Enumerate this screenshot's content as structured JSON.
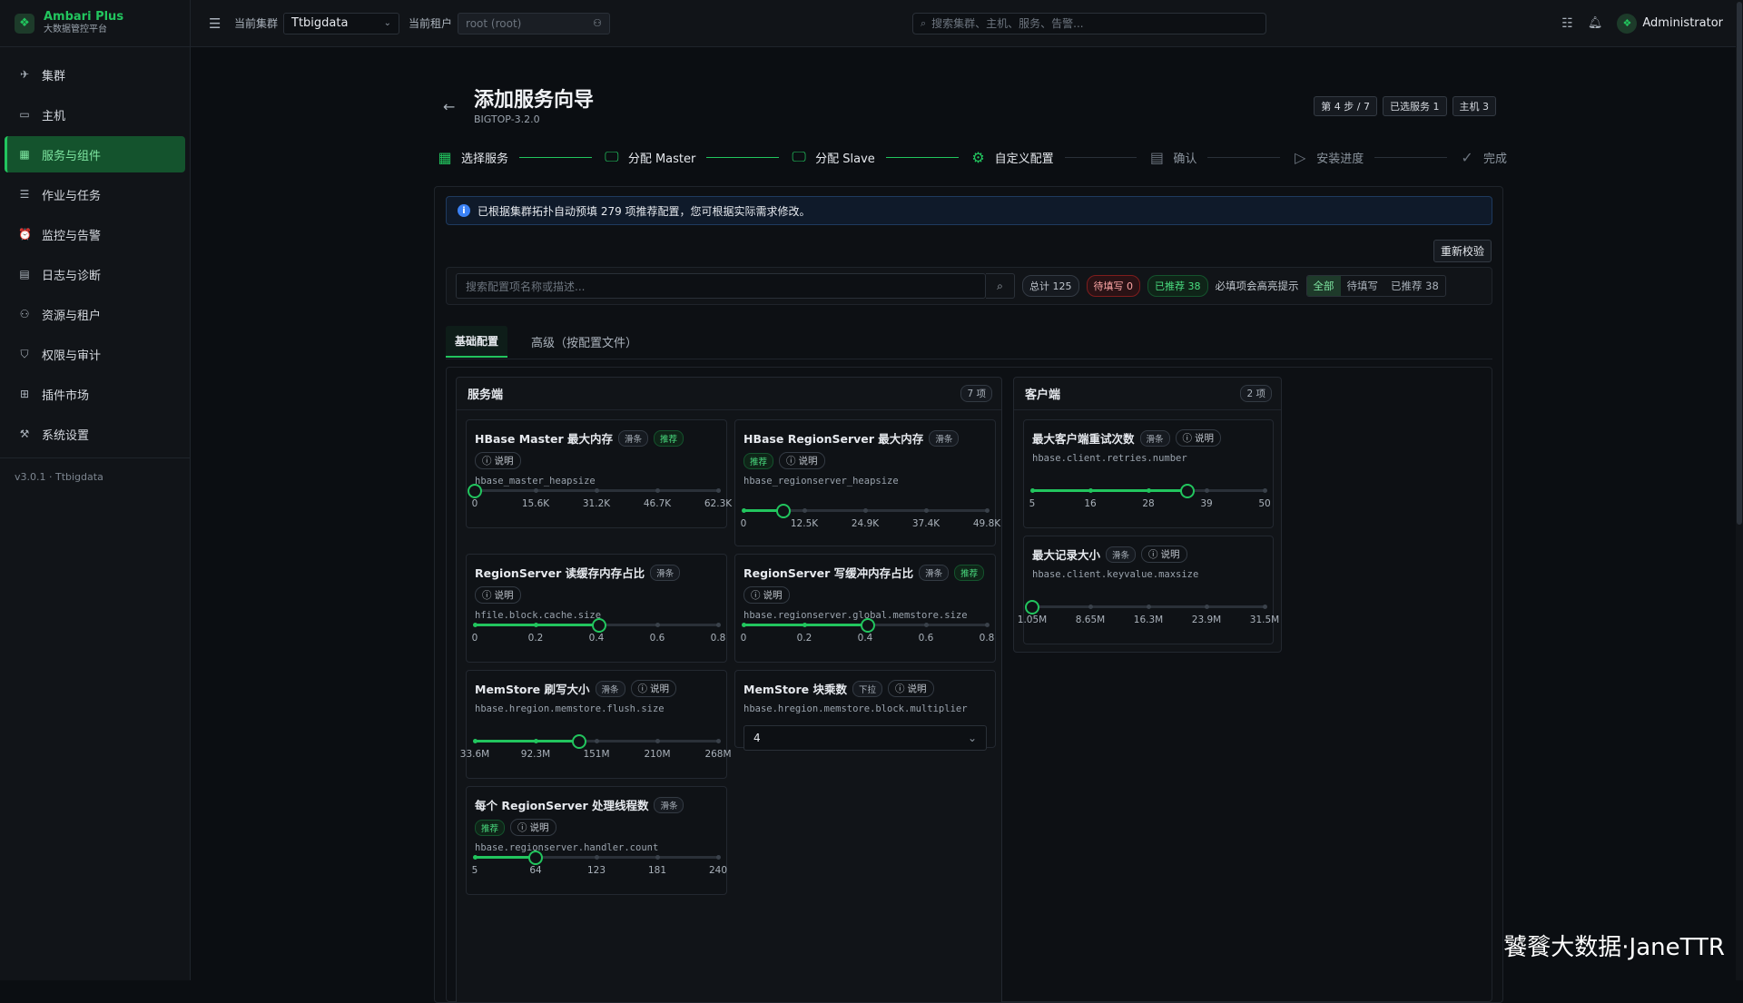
{
  "brand": {
    "title": "Ambari Plus",
    "subtitle": "大数据管控平台"
  },
  "sidebar": {
    "items": [
      {
        "label": "集群",
        "icon": "rocket-icon"
      },
      {
        "label": "主机",
        "icon": "monitor-icon"
      },
      {
        "label": "服务与组件",
        "icon": "grid-icon",
        "active": true
      },
      {
        "label": "作业与任务",
        "icon": "list-icon"
      },
      {
        "label": "监控与告警",
        "icon": "alarm-icon"
      },
      {
        "label": "日志与诊断",
        "icon": "log-icon"
      },
      {
        "label": "资源与租户",
        "icon": "users-icon"
      },
      {
        "label": "权限与审计",
        "icon": "shield-icon"
      },
      {
        "label": "插件市场",
        "icon": "puzzle-icon"
      },
      {
        "label": "系统设置",
        "icon": "wrench-icon"
      }
    ],
    "version": "v3.0.1 · Ttbigdata"
  },
  "topbar": {
    "cluster_label": "当前集群",
    "cluster_value": "Ttbigdata",
    "tenant_label": "当前租户",
    "tenant_placeholder": "root (root)",
    "search_placeholder": "搜索集群、主机、服务、告警...",
    "user": "Administrator"
  },
  "page": {
    "title": "添加服务向导",
    "subtitle": "BIGTOP-3.2.0",
    "badges": [
      "第 4 步 / 7",
      "已选服务 1",
      "主机 3"
    ]
  },
  "steps": [
    {
      "label": "选择服务",
      "state": "done",
      "icon": "grid-icon"
    },
    {
      "label": "分配 Master",
      "state": "done",
      "icon": "monitor-icon"
    },
    {
      "label": "分配 Slave",
      "state": "done",
      "icon": "monitor-icon"
    },
    {
      "label": "自定义配置",
      "state": "current",
      "icon": "gear-icon"
    },
    {
      "label": "确认",
      "state": "pending",
      "icon": "document-icon"
    },
    {
      "label": "安装进度",
      "state": "pending",
      "icon": "play-icon"
    },
    {
      "label": "完成",
      "state": "pending",
      "icon": "check-circle-icon"
    }
  ],
  "banner": "已根据集群拓扑自动预填 279 项推荐配置，您可根据实际需求修改。",
  "revalidate_label": "重新校验",
  "filter": {
    "search_placeholder": "搜索配置项名称或描述...",
    "total": "总计 125",
    "pending": "待填写 0",
    "recommended": "已推荐 38",
    "hint": "必填项会高亮提示",
    "segments": [
      "全部",
      "待填写",
      "已推荐 38"
    ],
    "active_segment": "全部"
  },
  "tabs": {
    "basic": "基础配置",
    "advanced": "高级（按配置文件）"
  },
  "common": {
    "explain": "说明",
    "slider_tag": "滑条",
    "dropdown_tag": "下拉",
    "recommended_tag": "推荐"
  },
  "server": {
    "title": "服务端",
    "count": "7 项",
    "cards": [
      {
        "title": "HBase Master 最大内存",
        "key": "hbase_master_heapsize",
        "recommended": true,
        "min": 0,
        "max": 62300,
        "value": 0,
        "marks": [
          "0",
          "15.6K",
          "31.2K",
          "46.7K",
          "62.3K"
        ]
      },
      {
        "title": "HBase RegionServer 最大内存",
        "key": "hbase_regionserver_heapsize",
        "recommended": true,
        "min": 0,
        "max": 49800,
        "value": 8200,
        "marks": [
          "0",
          "12.5K",
          "24.9K",
          "37.4K",
          "49.8K"
        ]
      },
      {
        "title": "RegionServer 读缓存内存占比",
        "key": "hfile.block.cache.size",
        "recommended": false,
        "min": 0,
        "max": 0.8,
        "value": 0.41,
        "marks": [
          "0",
          "0.2",
          "0.4",
          "0.6",
          "0.8"
        ]
      },
      {
        "title": "RegionServer 写缓冲内存占比",
        "key": "hbase.regionserver.global.memstore.size",
        "recommended": true,
        "min": 0,
        "max": 0.8,
        "value": 0.41,
        "marks": [
          "0",
          "0.2",
          "0.4",
          "0.6",
          "0.8"
        ]
      },
      {
        "title": "MemStore 刷写大小",
        "key": "hbase.hregion.memstore.flush.size",
        "recommended": false,
        "min": 0,
        "max": 1,
        "value": 0.43,
        "marks": [
          "33.6M",
          "92.3M",
          "151M",
          "210M",
          "268M"
        ]
      },
      {
        "title": "MemStore 块乘数",
        "key": "hbase.hregion.memstore.block.multiplier",
        "type": "dropdown",
        "selected": "4"
      },
      {
        "title": "每个 RegionServer 处理线程数",
        "key": "hbase.regionserver.handler.count",
        "recommended": true,
        "min": 5,
        "max": 240,
        "value": 64,
        "marks": [
          "5",
          "64",
          "123",
          "181",
          "240"
        ]
      }
    ]
  },
  "client": {
    "title": "客户端",
    "count": "2 项",
    "cards": [
      {
        "title": "最大客户端重试次数",
        "key": "hbase.client.retries.number",
        "min": 5,
        "max": 50,
        "value": 35,
        "marks": [
          "5",
          "16",
          "28",
          "39",
          "50"
        ]
      },
      {
        "title": "最大记录大小",
        "key": "hbase.client.keyvalue.maxsize",
        "min": 0,
        "max": 1,
        "value": 0,
        "marks": [
          "1.05M",
          "8.65M",
          "16.3M",
          "23.9M",
          "31.5M"
        ]
      }
    ]
  },
  "watermark": "饕餮大数据·JaneTTR",
  "colors": {
    "accent": "#22c55e",
    "background": "#0b0e12",
    "info": "#3b82f6",
    "danger": "#fca5a5"
  }
}
